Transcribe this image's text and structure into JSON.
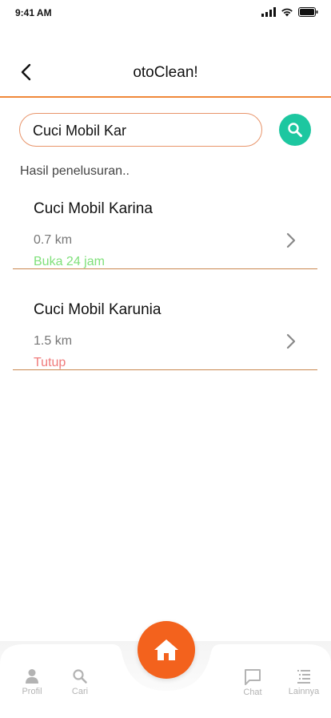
{
  "status_bar": {
    "time": "9:41 AM"
  },
  "header": {
    "title": "otoClean!"
  },
  "search": {
    "value": "Cuci Mobil Kar"
  },
  "results_label": "Hasil penelusuran..",
  "results": [
    {
      "name": "Cuci Mobil Karina",
      "distance": "0.7 km",
      "status": "Buka 24 jam",
      "status_color": "#7fe07a"
    },
    {
      "name": "Cuci Mobil Karunia",
      "distance": "1.5 km",
      "status": "Tutup",
      "status_color": "#f07a7a"
    }
  ],
  "nav": {
    "profile_label": "Profil",
    "search_label": "Cari",
    "chat_label": "Chat",
    "more_label": "Lainnya"
  },
  "colors": {
    "accent": "#f0893a",
    "search_button": "#1dc7a0",
    "home_button": "#f3621d"
  }
}
